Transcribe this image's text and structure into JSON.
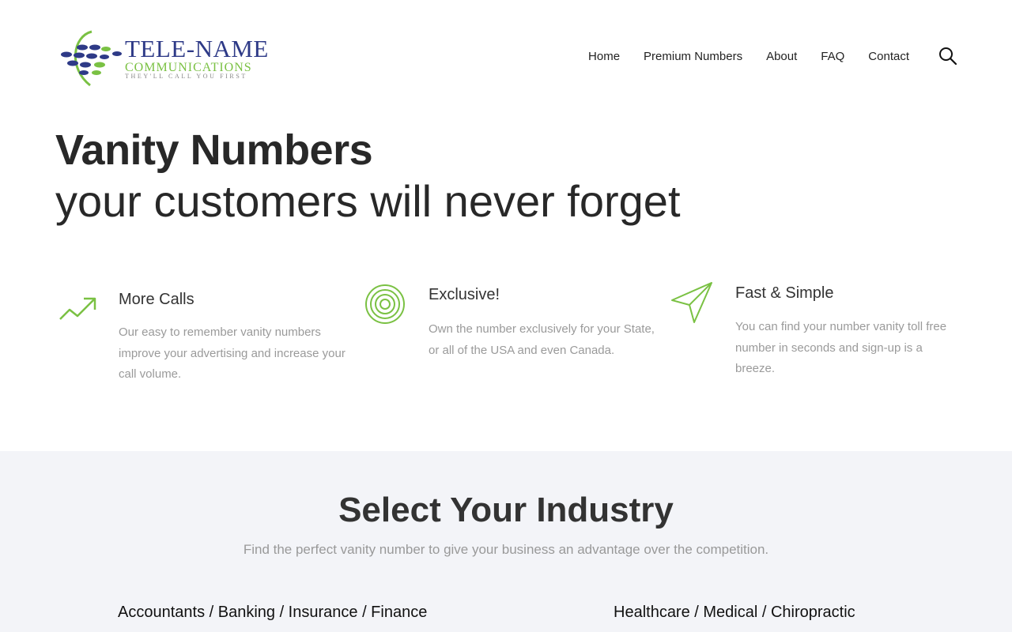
{
  "logo": {
    "brand": "TELE-NAME",
    "sub": "COMMUNICATIONS",
    "tagline": "THEY'LL CALL YOU FIRST"
  },
  "nav": {
    "items": [
      "Home",
      "Premium Numbers",
      "About",
      "FAQ",
      "Contact"
    ]
  },
  "icons": {
    "search": "search-icon",
    "feature1": "trending-up-icon",
    "feature2": "target-icon",
    "feature3": "paper-plane-icon"
  },
  "colors": {
    "brand_blue": "#2e3a87",
    "brand_green": "#7ac143",
    "text_dark": "#282828",
    "text_muted": "#9a9a9a",
    "section_bg": "#f3f4f8"
  },
  "hero": {
    "title": "Vanity Numbers",
    "subtitle": "your customers will never forget"
  },
  "features": [
    {
      "title": "More Calls",
      "text": "Our easy to remember vanity numbers improve your advertising and increase your call volume."
    },
    {
      "title": "Exclusive!",
      "text": "Own the number exclusively for your State, or all of the USA and even Canada."
    },
    {
      "title": "Fast & Simple",
      "text": "You can find your number vanity toll free number in seconds and sign-up is a breeze."
    }
  ],
  "industry": {
    "title": "Select Your Industry",
    "subtitle": "Find the perfect vanity number to give your business an advantage over the competition.",
    "items": [
      "Accountants / Banking / Insurance / Finance",
      "Healthcare / Medical / Chiropractic"
    ]
  }
}
